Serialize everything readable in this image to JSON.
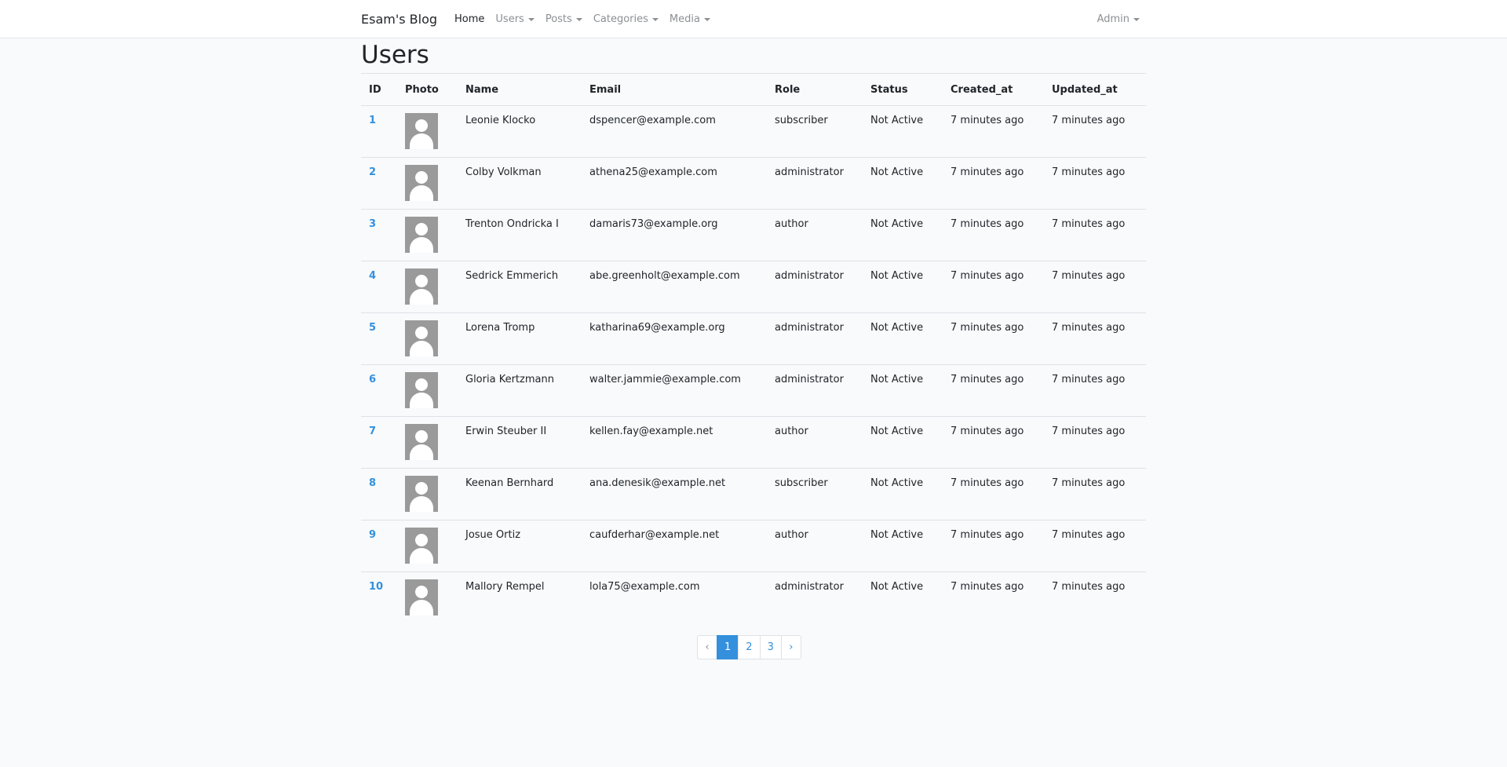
{
  "navbar": {
    "brand": "Esam's Blog",
    "links": [
      {
        "label": "Home"
      },
      {
        "label": "Users"
      },
      {
        "label": "Posts"
      },
      {
        "label": "Categories"
      },
      {
        "label": "Media"
      }
    ],
    "user_menu": "Admin"
  },
  "page": {
    "title": "Users"
  },
  "table": {
    "columns": [
      "ID",
      "Photo",
      "Name",
      "Email",
      "Role",
      "Status",
      "Created_at",
      "Updated_at"
    ],
    "rows": [
      {
        "id": "1",
        "name": "Leonie Klocko",
        "email": "dspencer@example.com",
        "role": "subscriber",
        "status": "Not Active",
        "created_at": "7 minutes ago",
        "updated_at": "7 minutes ago"
      },
      {
        "id": "2",
        "name": "Colby Volkman",
        "email": "athena25@example.com",
        "role": "administrator",
        "status": "Not Active",
        "created_at": "7 minutes ago",
        "updated_at": "7 minutes ago"
      },
      {
        "id": "3",
        "name": "Trenton Ondricka I",
        "email": "damaris73@example.org",
        "role": "author",
        "status": "Not Active",
        "created_at": "7 minutes ago",
        "updated_at": "7 minutes ago"
      },
      {
        "id": "4",
        "name": "Sedrick Emmerich",
        "email": "abe.greenholt@example.com",
        "role": "administrator",
        "status": "Not Active",
        "created_at": "7 minutes ago",
        "updated_at": "7 minutes ago"
      },
      {
        "id": "5",
        "name": "Lorena Tromp",
        "email": "katharina69@example.org",
        "role": "administrator",
        "status": "Not Active",
        "created_at": "7 minutes ago",
        "updated_at": "7 minutes ago"
      },
      {
        "id": "6",
        "name": "Gloria Kertzmann",
        "email": "walter.jammie@example.com",
        "role": "administrator",
        "status": "Not Active",
        "created_at": "7 minutes ago",
        "updated_at": "7 minutes ago"
      },
      {
        "id": "7",
        "name": "Erwin Steuber II",
        "email": "kellen.fay@example.net",
        "role": "author",
        "status": "Not Active",
        "created_at": "7 minutes ago",
        "updated_at": "7 minutes ago"
      },
      {
        "id": "8",
        "name": "Keenan Bernhard",
        "email": "ana.denesik@example.net",
        "role": "subscriber",
        "status": "Not Active",
        "created_at": "7 minutes ago",
        "updated_at": "7 minutes ago"
      },
      {
        "id": "9",
        "name": "Josue Ortiz",
        "email": "caufderhar@example.net",
        "role": "author",
        "status": "Not Active",
        "created_at": "7 minutes ago",
        "updated_at": "7 minutes ago"
      },
      {
        "id": "10",
        "name": "Mallory Rempel",
        "email": "lola75@example.com",
        "role": "administrator",
        "status": "Not Active",
        "created_at": "7 minutes ago",
        "updated_at": "7 minutes ago"
      }
    ]
  },
  "pagination": {
    "prev": "‹",
    "pages": [
      "1",
      "2",
      "3"
    ],
    "current": "1",
    "next": "›"
  },
  "colors": {
    "accent": "#3490dc",
    "background": "#f8fafc",
    "avatar_placeholder": "#9a9a9a"
  }
}
